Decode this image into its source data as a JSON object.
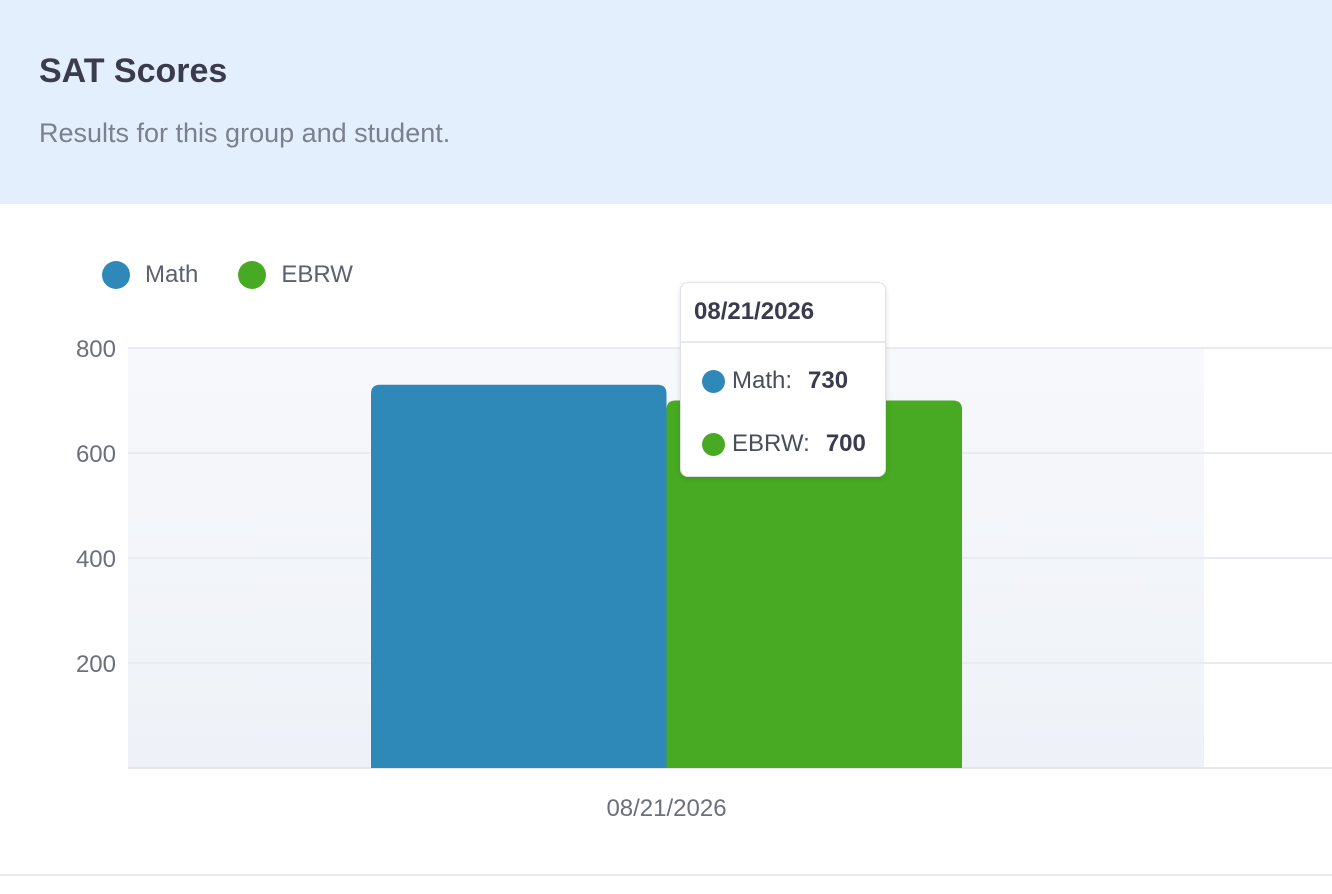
{
  "header": {
    "title": "SAT Scores",
    "subtitle": "Results for this group and student."
  },
  "colors": {
    "math": "#2e89b8",
    "ebrw": "#48aa22"
  },
  "chart_data": {
    "type": "bar",
    "categories": [
      "08/21/2026"
    ],
    "series": [
      {
        "name": "Math",
        "values": [
          730
        ],
        "color": "#2e89b8"
      },
      {
        "name": "EBRW",
        "values": [
          700
        ],
        "color": "#48aa22"
      }
    ],
    "ylim": [
      0,
      800
    ],
    "yticks": [
      200,
      400,
      600,
      800
    ],
    "grid": true,
    "legend": "top-left"
  },
  "tooltip": {
    "title": "08/21/2026",
    "rows": [
      {
        "label": "Math:",
        "value": "730",
        "color": "#2e89b8"
      },
      {
        "label": "EBRW:",
        "value": "700",
        "color": "#48aa22"
      }
    ]
  }
}
